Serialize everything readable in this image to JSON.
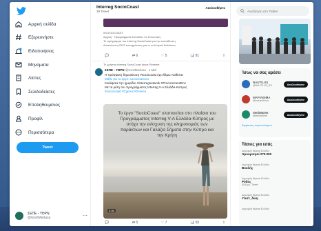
{
  "nav": {
    "items": [
      {
        "label": "Αρχική σελίδα",
        "icon": "home-icon"
      },
      {
        "label": "Εξερευνήστε",
        "icon": "hashtag-icon"
      },
      {
        "label": "Ειδοποιήσεις",
        "icon": "bell-icon"
      },
      {
        "label": "Μηνύματα",
        "icon": "mail-icon"
      },
      {
        "label": "Λίστες",
        "icon": "list-icon"
      },
      {
        "label": "Σελιδοδείκτες",
        "icon": "bookmark-icon"
      },
      {
        "label": "Επαληθευμένος",
        "icon": "verified-icon"
      },
      {
        "label": "Προφίλ",
        "icon": "profile-icon"
      },
      {
        "label": "Περισσότερα",
        "icon": "more-icon"
      }
    ],
    "tweet_button": "Tweet",
    "profile_name": "ΣΕΠΕ - ΥΘΡΝ",
    "profile_handle": "@GovtMedusa"
  },
  "header": {
    "title": "Interreg SocioCoast",
    "subtitle": "39 Tweet",
    "follow": "Ακολουθήστε"
  },
  "first_tweet": {
    "line1": "#SOCIOCOAST",
    "line2": "Αρχική · Προγράμματα Σπουδών Σε Κοινωνική",
    "line3": "Το πρόγραμμα του Interreg SocioCoast για την εκπαίδευση",
    "line4": "Ανακοίνωση 2022 επισημάνσεις για το συλλογικό θαλάσσιο",
    "reply": "",
    "retweet": "6",
    "like": "5",
    "views": "81"
  },
  "second_tweet": {
    "retweeted_by": "Το χρήστη Interreg SocioCoast έκανε Retweet",
    "author": "ΣΕΠΕ - ΥΘΡΝ",
    "handle": "@GovtMedusa · 4 Μαΐ",
    "body1": "Η πρόσφατη δημοσίευση #sociocoast έχει θέμα: Καθίστε!",
    "body2": "Μάθε για το έργο: sociocoast.eu",
    "body3": "Καλύψατε την ημερίδα: #interregnetwork #ProcurementEnv",
    "body4": "Με τα μέλη του προγράμματος Interreg V-A Ελλάδα-Κύπρος",
    "body5": "#sociocoast #Cyprus #Greece",
    "caption": "Το έργο \"SocioCoast\" υλοποιείται στο πλαίσιο του Προγράμματος Interreg V-A Ελλάδα-Κύπρος με στόχο την ενίσχυση της κληρονομιάς των παράκτιων και Γαλάζιο Σήματα στην Κύπρο και την Κρήτη",
    "timer": "0:06",
    "reply": "",
    "retweet": "5",
    "like": "7",
    "views": "65"
  },
  "search": {
    "placeholder": "Αναζήτηση στο Twitter"
  },
  "suggestions": {
    "title": "Ίσως να σας αρέσει",
    "users": [
      {
        "name": "NAUTILUS",
        "handle": "@NAUTILUS_RG",
        "color": "#2a6db8",
        "button": "Ακολουθήστε"
      },
      {
        "name": "ΜΑΡΙΑΘΙΜΑ",
        "handle": "@marianthima",
        "color": "#c0392b",
        "button": "Ακολουθήστε"
      },
      {
        "name": "MedWaNet",
        "handle": "@MedWaNet",
        "color": "#1b8a6b",
        "button": "Ακολουθήστε"
      }
    ],
    "more": "Εμφάνιση περισσότερων"
  },
  "trends": {
    "title": "Τάσεις για εσάς",
    "items": [
      {
        "category": "Δημοφιλή θέματα Ελλάδα",
        "topic": "προορισμοί 270.000",
        "count": ""
      },
      {
        "category": "Δημοφιλή θέματα Ελλάδα",
        "topic": "Βουλής",
        "count": ""
      },
      {
        "category": "Δημοφιλή θέματα Ελλάδα",
        "topic": "Ρόδος",
        "count": "35,6 χιλ. Tweet"
      },
      {
        "category": "Δημοφιλή θέματα Ελλάδα",
        "topic": "#τεστ_δικη",
        "count": ""
      },
      {
        "category": "Δημοφιλή θέματα Ελλάδα",
        "topic": "",
        "count": ""
      }
    ]
  },
  "colors": {
    "accent": "#1d9bf0",
    "header_card": "#5b3360"
  }
}
